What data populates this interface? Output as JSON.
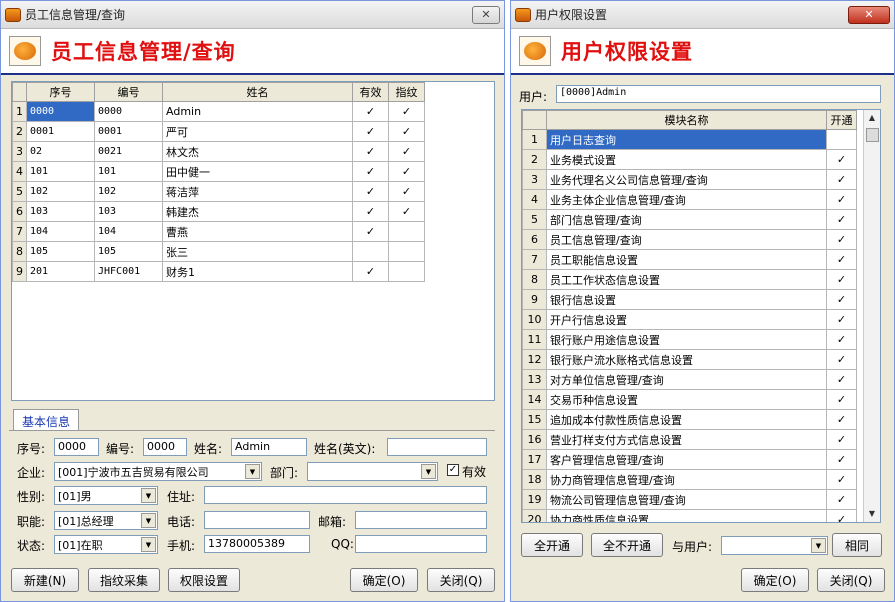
{
  "left": {
    "title": "员工信息管理/查询",
    "header_title": "员工信息管理/查询",
    "columns": [
      "序号",
      "编号",
      "姓名",
      "有效",
      "指纹"
    ],
    "rows": [
      {
        "n": "1",
        "seq": "0000",
        "code": "0000",
        "name": "Admin",
        "valid": "✓",
        "finger": "✓"
      },
      {
        "n": "2",
        "seq": "0001",
        "code": "0001",
        "name": "严可",
        "valid": "✓",
        "finger": "✓"
      },
      {
        "n": "3",
        "seq": "02",
        "code": "0021",
        "name": "林文杰",
        "valid": "✓",
        "finger": "✓"
      },
      {
        "n": "4",
        "seq": "101",
        "code": "101",
        "name": "田中健一",
        "valid": "✓",
        "finger": "✓"
      },
      {
        "n": "5",
        "seq": "102",
        "code": "102",
        "name": "蒋洁萍",
        "valid": "✓",
        "finger": "✓"
      },
      {
        "n": "6",
        "seq": "103",
        "code": "103",
        "name": "韩建杰",
        "valid": "✓",
        "finger": "✓"
      },
      {
        "n": "7",
        "seq": "104",
        "code": "104",
        "name": "曹燕",
        "valid": "✓",
        "finger": ""
      },
      {
        "n": "8",
        "seq": "105",
        "code": "105",
        "name": "张三",
        "valid": "",
        "finger": ""
      },
      {
        "n": "9",
        "seq": "201",
        "code": "JHFC001",
        "name": "财务1",
        "valid": "✓",
        "finger": ""
      }
    ],
    "tab_label": "基本信息",
    "form": {
      "seq_label": "序号:",
      "seq_value": "0000",
      "code_label": "编号:",
      "code_value": "0000",
      "name_label": "姓名:",
      "name_value": "Admin",
      "name_en_label": "姓名(英文):",
      "name_en_value": "",
      "company_label": "企业:",
      "company_value": "[001]宁波市五吉贸易有限公司",
      "dept_label": "部门:",
      "dept_value": "",
      "valid_label": "有效",
      "valid_checked": "✓",
      "gender_label": "性别:",
      "gender_value": "[01]男",
      "address_label": "住址:",
      "address_value": "",
      "position_label": "职能:",
      "position_value": "[01]总经理",
      "phone_label": "电话:",
      "phone_value": "",
      "email_label": "邮箱:",
      "email_value": "",
      "status_label": "状态:",
      "status_value": "[01]在职",
      "mobile_label": "手机:",
      "mobile_value": "13780005389",
      "qq_label": "QQ:",
      "qq_value": ""
    },
    "buttons": {
      "new": "新建(N)",
      "finger": "指纹采集",
      "perm": "权限设置",
      "ok": "确定(O)",
      "close": "关闭(Q)"
    }
  },
  "right": {
    "title": "用户权限设置",
    "header_title": "用户权限设置",
    "user_label": "用户:",
    "user_value": "[0000]Admin",
    "columns": [
      "模块名称",
      "开通"
    ],
    "rows": [
      {
        "n": "1",
        "name": "用户日志查询",
        "on": ""
      },
      {
        "n": "2",
        "name": "业务模式设置",
        "on": "✓"
      },
      {
        "n": "3",
        "name": "业务代理名义公司信息管理/查询",
        "on": "✓"
      },
      {
        "n": "4",
        "name": "业务主体企业信息管理/查询",
        "on": "✓"
      },
      {
        "n": "5",
        "name": "部门信息管理/查询",
        "on": "✓"
      },
      {
        "n": "6",
        "name": "员工信息管理/查询",
        "on": "✓"
      },
      {
        "n": "7",
        "name": "员工职能信息设置",
        "on": "✓"
      },
      {
        "n": "8",
        "name": "员工工作状态信息设置",
        "on": "✓"
      },
      {
        "n": "9",
        "name": "银行信息设置",
        "on": "✓"
      },
      {
        "n": "10",
        "name": "开户行信息设置",
        "on": "✓"
      },
      {
        "n": "11",
        "name": "银行账户用途信息设置",
        "on": "✓"
      },
      {
        "n": "12",
        "name": "银行账户流水账格式信息设置",
        "on": "✓"
      },
      {
        "n": "13",
        "name": "对方单位信息管理/查询",
        "on": "✓"
      },
      {
        "n": "14",
        "name": "交易币种信息设置",
        "on": "✓"
      },
      {
        "n": "15",
        "name": "追加成本付款性质信息设置",
        "on": "✓"
      },
      {
        "n": "16",
        "name": "营业打样支付方式信息设置",
        "on": "✓"
      },
      {
        "n": "17",
        "name": "客户管理信息管理/查询",
        "on": "✓"
      },
      {
        "n": "18",
        "name": "协力商管理信息管理/查询",
        "on": "✓"
      },
      {
        "n": "19",
        "name": "物流公司管理信息管理/查询",
        "on": "✓"
      },
      {
        "n": "20",
        "name": "协力商性质信息设置",
        "on": "✓"
      }
    ],
    "buttons": {
      "all_on": "全开通",
      "all_off": "全不开通",
      "with_user": "与用户:",
      "same": "相同",
      "ok": "确定(O)",
      "close": "关闭(Q)"
    },
    "with_user_value": ""
  }
}
